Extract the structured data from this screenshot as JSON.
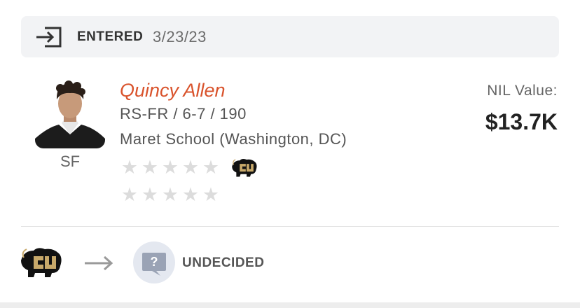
{
  "status": {
    "icon": "enter-icon",
    "label": "ENTERED",
    "date": "3/23/23"
  },
  "player": {
    "name": "Quincy Allen",
    "meta": "RS-FR / 6-7 / 190",
    "school": "Maret School (Washington, DC)",
    "position": "SF",
    "stars_row1": 5,
    "stars_row1_filled": 0,
    "stars_row2": 5,
    "stars_row2_filled": 0,
    "team_logo": "colorado-buffaloes-logo"
  },
  "nil": {
    "label": "NIL Value:",
    "value": "$13.7K"
  },
  "transfer": {
    "from_logo": "colorado-buffaloes-logo",
    "arrow": "arrow-right-icon",
    "to_icon": "question-bubble-icon",
    "to_label": "UNDECIDED"
  },
  "colors": {
    "name": "#d9532c",
    "star_empty": "#dcdcdc",
    "status_bg": "#f2f3f5",
    "logo_gold": "#c8a96a"
  }
}
